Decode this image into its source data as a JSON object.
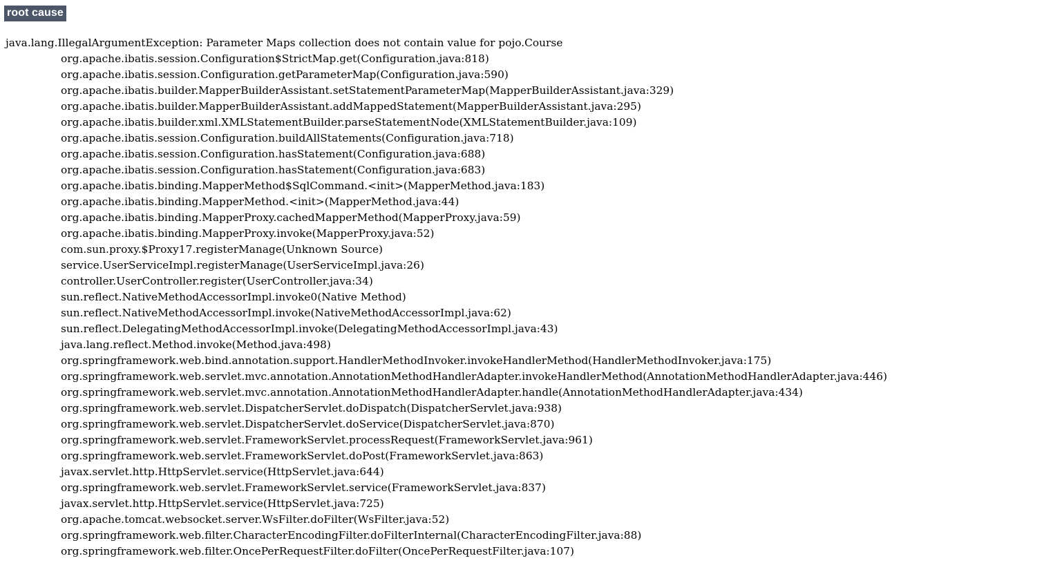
{
  "header": {
    "label": "root cause",
    "highlight_color": "#4d5669",
    "text_color": "#ffffff"
  },
  "stacktrace": {
    "message": "java.lang.IllegalArgumentException: Parameter Maps collection does not contain value for pojo.Course",
    "frames": [
      "org.apache.ibatis.session.Configuration$StrictMap.get(Configuration.java:818)",
      "org.apache.ibatis.session.Configuration.getParameterMap(Configuration.java:590)",
      "org.apache.ibatis.builder.MapperBuilderAssistant.setStatementParameterMap(MapperBuilderAssistant.java:329)",
      "org.apache.ibatis.builder.MapperBuilderAssistant.addMappedStatement(MapperBuilderAssistant.java:295)",
      "org.apache.ibatis.builder.xml.XMLStatementBuilder.parseStatementNode(XMLStatementBuilder.java:109)",
      "org.apache.ibatis.session.Configuration.buildAllStatements(Configuration.java:718)",
      "org.apache.ibatis.session.Configuration.hasStatement(Configuration.java:688)",
      "org.apache.ibatis.session.Configuration.hasStatement(Configuration.java:683)",
      "org.apache.ibatis.binding.MapperMethod$SqlCommand.<init>(MapperMethod.java:183)",
      "org.apache.ibatis.binding.MapperMethod.<init>(MapperMethod.java:44)",
      "org.apache.ibatis.binding.MapperProxy.cachedMapperMethod(MapperProxy.java:59)",
      "org.apache.ibatis.binding.MapperProxy.invoke(MapperProxy.java:52)",
      "com.sun.proxy.$Proxy17.registerManage(Unknown Source)",
      "service.UserServiceImpl.registerManage(UserServiceImpl.java:26)",
      "controller.UserController.register(UserController.java:34)",
      "sun.reflect.NativeMethodAccessorImpl.invoke0(Native Method)",
      "sun.reflect.NativeMethodAccessorImpl.invoke(NativeMethodAccessorImpl.java:62)",
      "sun.reflect.DelegatingMethodAccessorImpl.invoke(DelegatingMethodAccessorImpl.java:43)",
      "java.lang.reflect.Method.invoke(Method.java:498)",
      "org.springframework.web.bind.annotation.support.HandlerMethodInvoker.invokeHandlerMethod(HandlerMethodInvoker.java:175)",
      "org.springframework.web.servlet.mvc.annotation.AnnotationMethodHandlerAdapter.invokeHandlerMethod(AnnotationMethodHandlerAdapter.java:446)",
      "org.springframework.web.servlet.mvc.annotation.AnnotationMethodHandlerAdapter.handle(AnnotationMethodHandlerAdapter.java:434)",
      "org.springframework.web.servlet.DispatcherServlet.doDispatch(DispatcherServlet.java:938)",
      "org.springframework.web.servlet.DispatcherServlet.doService(DispatcherServlet.java:870)",
      "org.springframework.web.servlet.FrameworkServlet.processRequest(FrameworkServlet.java:961)",
      "org.springframework.web.servlet.FrameworkServlet.doPost(FrameworkServlet.java:863)",
      "javax.servlet.http.HttpServlet.service(HttpServlet.java:644)",
      "org.springframework.web.servlet.FrameworkServlet.service(FrameworkServlet.java:837)",
      "javax.servlet.http.HttpServlet.service(HttpServlet.java:725)",
      "org.apache.tomcat.websocket.server.WsFilter.doFilter(WsFilter.java:52)",
      "org.springframework.web.filter.CharacterEncodingFilter.doFilterInternal(CharacterEncodingFilter.java:88)",
      "org.springframework.web.filter.OncePerRequestFilter.doFilter(OncePerRequestFilter.java:107)"
    ]
  }
}
